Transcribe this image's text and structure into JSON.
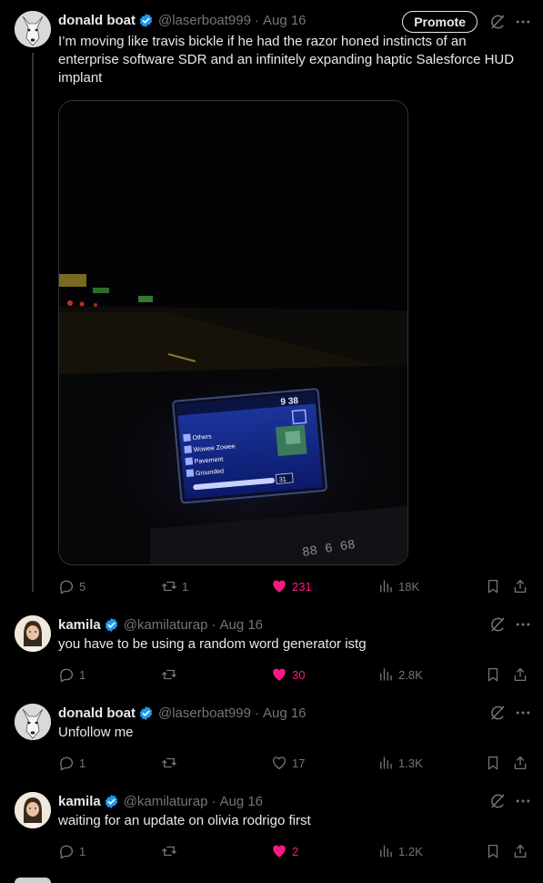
{
  "colors": {
    "background": "#000000",
    "text": "#e7e9ea",
    "muted": "#71767b",
    "like": "#f91880",
    "verified": "#1d9bf0",
    "divider": "#2f3336"
  },
  "promote_label": "Promote",
  "tweets": [
    {
      "name": "donald boat",
      "handle": "@laserboat999",
      "date": "Aug 16",
      "text": "I’m moving like travis bickle if he had the razor honed instincts of an enterprise software SDR and an infinitely expanding haptic Salesforce HUD implant",
      "replies": "5",
      "retweets": "1",
      "likes": "231",
      "views": "18K",
      "liked": true,
      "media": {
        "clock": "9 38",
        "sources": [
          "Others",
          "Wowee Zowee",
          "Pavement",
          "Grounded"
        ],
        "volume": "31",
        "dash_code": "88 6 68"
      }
    },
    {
      "name": "kamila",
      "handle": "@kamilaturap",
      "date": "Aug 16",
      "text": "you have to be using a random word generator istg",
      "replies": "1",
      "retweets": "",
      "likes": "30",
      "views": "2.8K",
      "liked": true
    },
    {
      "name": "donald boat",
      "handle": "@laserboat999",
      "date": "Aug 16",
      "text": "Unfollow me",
      "replies": "1",
      "retweets": "",
      "likes": "17",
      "views": "1.3K",
      "liked": false
    },
    {
      "name": "kamila",
      "handle": "@kamilaturap",
      "date": "Aug 16",
      "text": "waiting for an update on olivia rodrigo first",
      "replies": "1",
      "retweets": "",
      "likes": "2",
      "views": "1.2K",
      "liked": true
    }
  ]
}
